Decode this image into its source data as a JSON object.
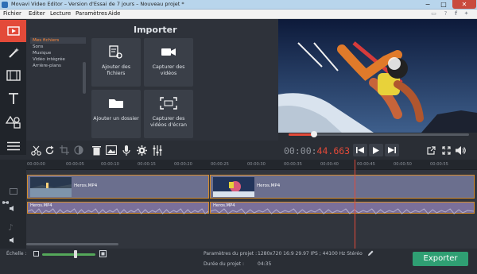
{
  "window": {
    "title": "Movavi Video Editor – Version d'Essai de 7 jours – Nouveau projet *",
    "minimize": "−",
    "maximize": "□",
    "close": "✕"
  },
  "menu": {
    "items": [
      "Fichier",
      "Editer",
      "Lecture",
      "Paramètres",
      "Aide"
    ],
    "social_icons": [
      "screen-icon",
      "help-icon",
      "facebook-icon",
      "twitter-icon"
    ]
  },
  "sidebar": {
    "items": [
      "import-icon",
      "magic-wand-icon",
      "filters-icon",
      "text-icon",
      "shapes-icon",
      "menu-icon"
    ]
  },
  "importer": {
    "title": "Importer",
    "categories": [
      "Mes fichiers",
      "Sons",
      "Musique",
      "Vidéo intégrée",
      "Arrière-plans"
    ],
    "selected_category": "Mes fichiers",
    "tiles": [
      {
        "label": "Ajouter des fichiers",
        "icon": "add-files-icon"
      },
      {
        "label": "Capturer des vidéos",
        "icon": "camera-icon"
      },
      {
        "label": "Ajouter un dossier",
        "icon": "folder-icon"
      },
      {
        "label": "Capturer des vidéos d'écran",
        "icon": "screen-capture-icon"
      }
    ]
  },
  "player": {
    "timecode_static": "00:00:",
    "timecode_live": "44.663",
    "progress": 0.14
  },
  "toolbar": {
    "icons": [
      "cut-icon",
      "rotate-icon",
      "crop-icon",
      "color-icon",
      "trash-icon",
      "image-icon",
      "mic-icon",
      "gear-icon",
      "equalizer-icon"
    ]
  },
  "timeline": {
    "ticks": [
      "00:00:00",
      "00:00:05",
      "00:00:10",
      "00:00:15",
      "00:00:20",
      "00:00:25",
      "00:00:30",
      "00:00:35",
      "00:00:40",
      "00:00:45",
      "00:00:50",
      "00:00:55"
    ],
    "video_clips": [
      {
        "name": "Heros.MP4"
      },
      {
        "name": "Heros.MP4"
      }
    ],
    "audio_clips": [
      {
        "name": "Heros.MP4"
      },
      {
        "name": "Heros.MP4"
      }
    ]
  },
  "footer": {
    "scale_label": "Échelle :",
    "project_params_label": "Paramètres du projet :",
    "project_params_value": "1280x720 16:9 29.97 IPS ; 44100 Hz Stéréo",
    "duration_label": "Durée du projet :",
    "duration_value": "04:35",
    "export_label": "Exporter",
    "zoom_level": 0.62
  },
  "colors": {
    "accent": "#e34a39",
    "export": "#2f9f73",
    "selected_text": "#ff8a3c"
  }
}
